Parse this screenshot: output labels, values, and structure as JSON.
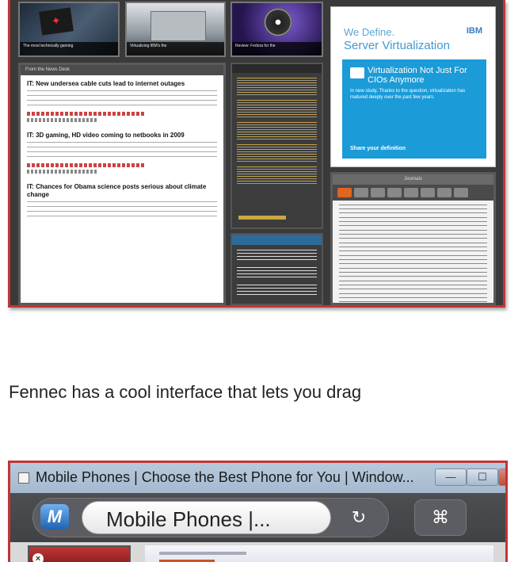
{
  "caption": "Fennec has a cool interface that lets you drag",
  "screenshot1": {
    "tiles": [
      {
        "caption": "The most technically gaming"
      },
      {
        "caption": "Virtualizing IBM's the"
      },
      {
        "caption": "Review: Fedora for the"
      }
    ],
    "ad": {
      "line1": "We Define.",
      "line2": "Server Virtualization",
      "brand": "IBM",
      "box_heading": "Virtualization Not Just For CIOs Anymore",
      "box_body": "In new study, Thanks to the question, virtualization has matured deeply over the past few years.",
      "box_more": "Share your definition"
    },
    "news": {
      "header": "From the News Desk",
      "articles": [
        {
          "title": "IT: New undersea cable cuts lead to internet outages"
        },
        {
          "title": "IT: 3D gaming, HD video coming to netbooks in 2009"
        },
        {
          "title": "IT: Chances for Obama science posts serious about climate change"
        }
      ]
    },
    "journals": {
      "header": "Journals"
    }
  },
  "browser": {
    "window_title": "Mobile Phones | Choose the Best Phone for You | Window...",
    "minimize_icon": "—",
    "maximize_icon": "☐",
    "close_icon": "X",
    "app_icon_label": "M",
    "url_text": "Mobile Phones |...",
    "reload_icon": "↻",
    "bookmarks_icon": "⌘",
    "tab_close_icon": "×"
  }
}
